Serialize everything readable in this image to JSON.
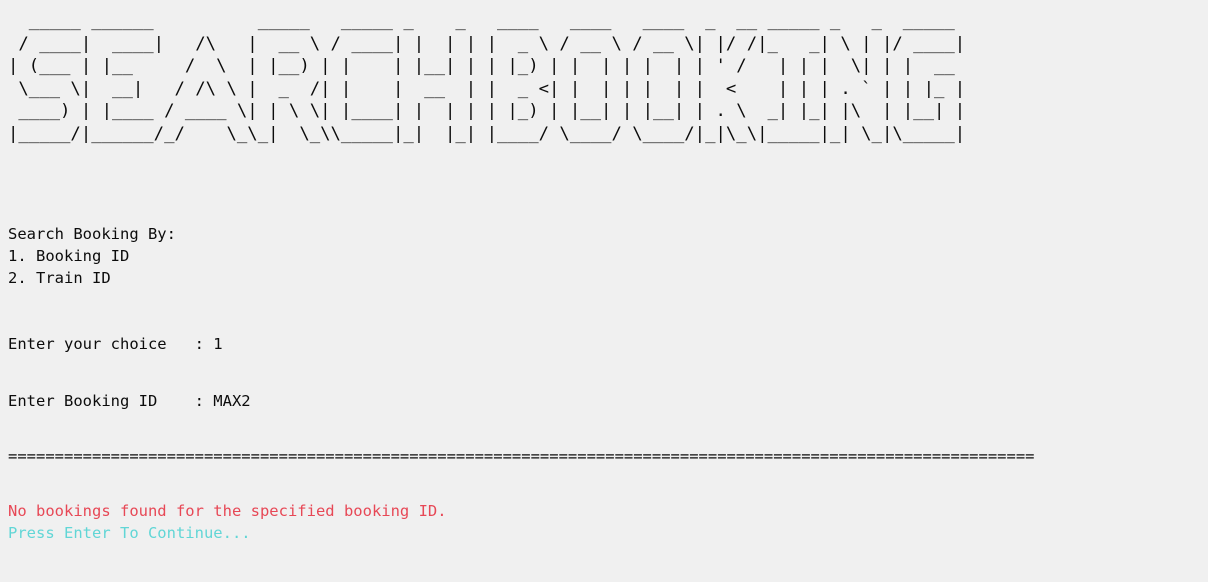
{
  "console": {
    "banner_ascii": "  _____ ______          _____   _____ _    _   ____   ____   ____  _  __ _____ _   _  _____ \n / ____|  ____|   /\\   |  __ \\ / ____| |  | | |  _ \\ / __ \\ / __ \\| |/ /|_   _| \\ | |/ ____|\n| (___ | |__     /  \\  | |__) | |    | |__| | | |_) | |  | | |  | | ' /   | | |  \\| | |  __ \n \\___ \\|  __|   / /\\ \\ |  _  /| |    |  __  | |  _ <| |  | | |  | |  <    | | | . ` | | |_ |\n ____) | |____ / ____ \\| | \\ \\| |____| |  | | | |_) | |__| | |__| | . \\  _| |_| |\\  | |__| |\n|_____/|______/_/    \\_\\_|  \\_\\\\_____|_|  |_| |____/ \\____/ \\____/|_|\\_\\|_____|_| \\_|\\_____|",
    "menu_title": "Search Booking By:",
    "option_1": "1. Booking ID",
    "option_2": "2. Train ID",
    "choice_prompt": "Enter your choice   : 1",
    "booking_id_prompt": "Enter Booking ID    : MAX2",
    "separator": "==============================================================================================================",
    "error_message": "No bookings found for the specified booking ID.",
    "continue_prompt": "Press Enter To Continue..."
  },
  "colors": {
    "background": "#f0f0f0",
    "text": "#0c0c0c",
    "error": "#e74856",
    "prompt": "#61d6d6"
  }
}
